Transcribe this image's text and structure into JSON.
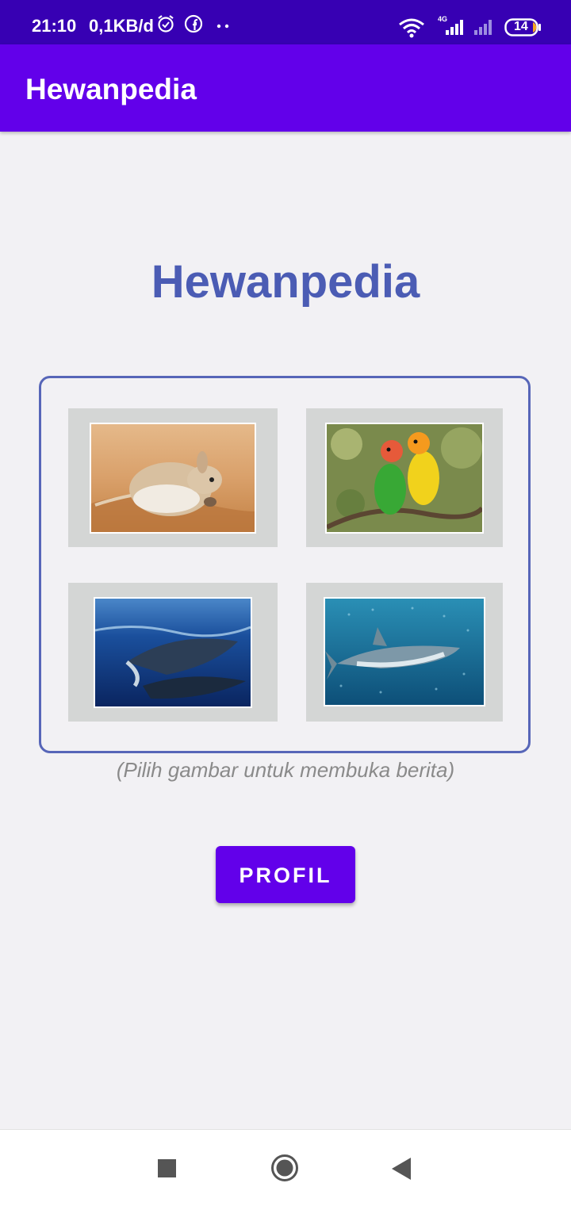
{
  "status_bar": {
    "time": "21:10",
    "net_speed": "0,1KB/d",
    "network_type": "4G",
    "battery": "14",
    "icons": [
      "alarm-icon",
      "facebook-icon",
      "more-dots-icon",
      "wifi-icon",
      "signal-4g-icon",
      "signal-weak-icon",
      "battery-icon"
    ]
  },
  "app_bar": {
    "title": "Hewanpedia"
  },
  "main": {
    "heading": "Hewanpedia",
    "hint": "(Pilih gambar untuk membuka berita)",
    "profile_button": "PROFIL",
    "animals": [
      {
        "name": "jerboa",
        "image": "jerboa-photo"
      },
      {
        "name": "lovebirds",
        "image": "lovebirds-photo"
      },
      {
        "name": "whales",
        "image": "humpback-whales-photo"
      },
      {
        "name": "shark",
        "image": "shark-photo"
      }
    ]
  },
  "nav_bar": {
    "icons": [
      "recents-square-icon",
      "home-circle-icon",
      "back-triangle-icon"
    ]
  },
  "colors": {
    "status_bar": "#3700b3",
    "app_bar": "#6200ea",
    "heading": "#4b5cb4",
    "frame_border": "#5766b8",
    "card_bg": "#d4d6d5",
    "background": "#f2f1f4",
    "hint": "#8a8a8a"
  }
}
